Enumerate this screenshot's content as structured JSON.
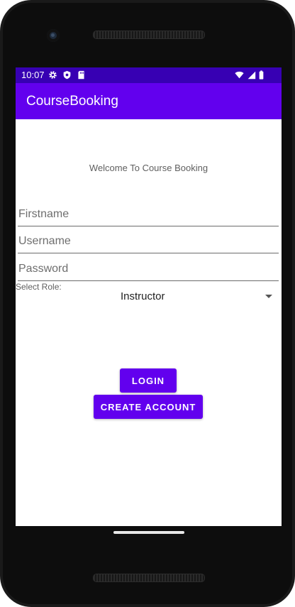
{
  "status_bar": {
    "time": "10:07",
    "icons_left": [
      "gear-icon",
      "shield-icon",
      "sd-card-icon"
    ],
    "icons_right": [
      "wifi-icon",
      "signal-icon",
      "battery-icon"
    ]
  },
  "app_bar": {
    "title": "CourseBooking"
  },
  "main": {
    "welcome_text": "Welcome To Course Booking",
    "firstname_placeholder": "Firstname",
    "username_placeholder": "Username",
    "password_placeholder": "Password",
    "role_label": "Select Role:",
    "role_selected": "Instructor",
    "login_label": "LOGIN",
    "create_account_label": "CREATE ACCOUNT"
  },
  "colors": {
    "status_bar": "#3700b3",
    "app_bar": "#6200ee",
    "button": "#6200ee"
  }
}
